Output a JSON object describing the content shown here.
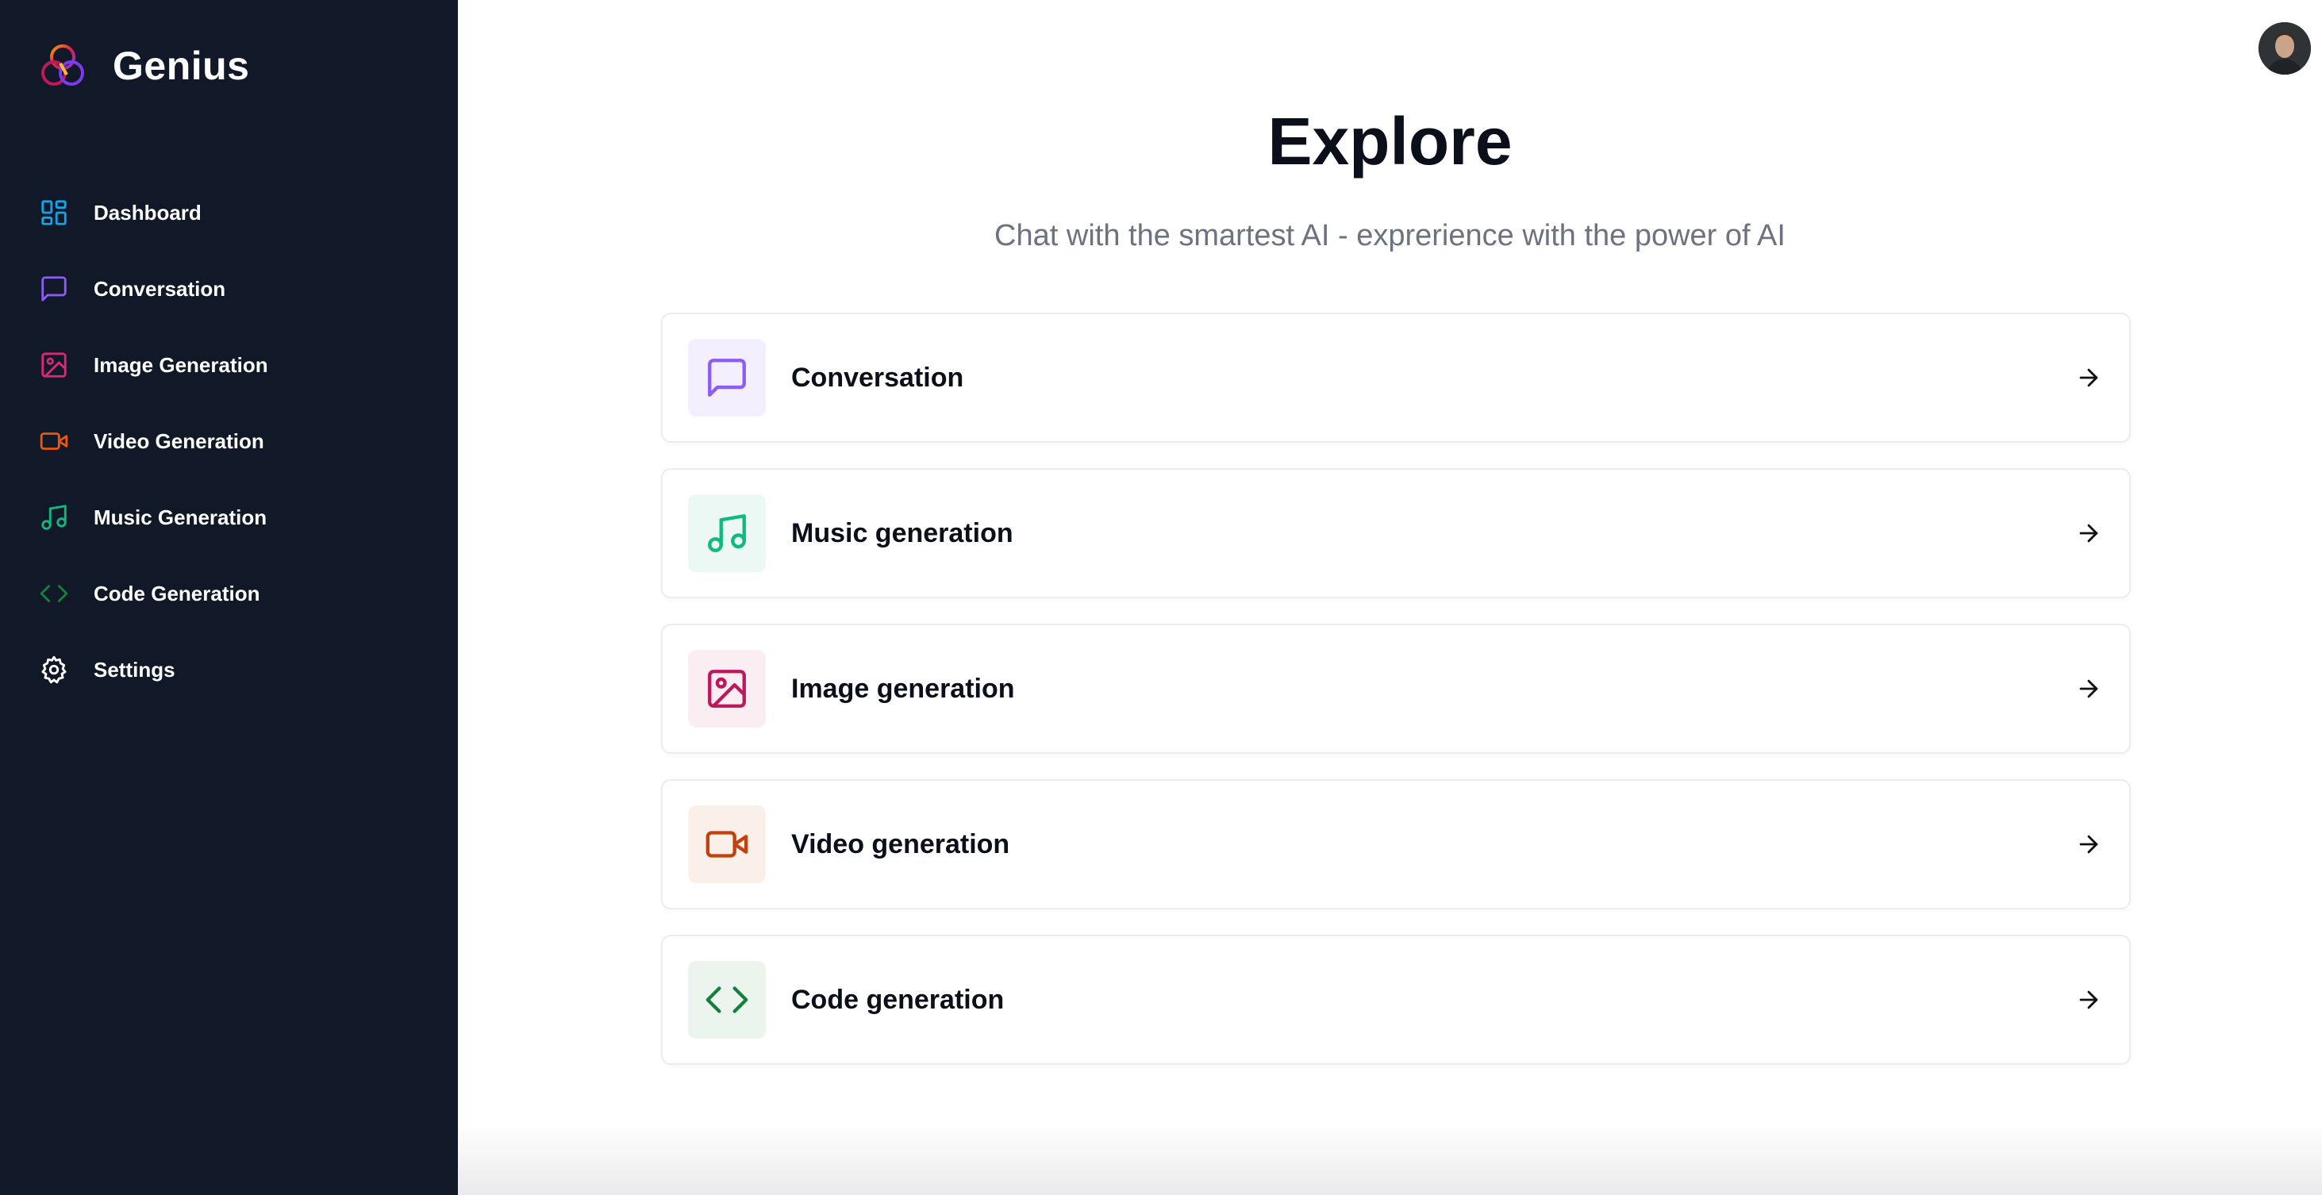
{
  "brand": {
    "name": "Genius",
    "icon": "genius-logo"
  },
  "sidebar": {
    "items": [
      {
        "label": "Dashboard",
        "icon": "dashboard-icon",
        "color": "#0ea5e9"
      },
      {
        "label": "Conversation",
        "icon": "message-square-icon",
        "color": "#8b5cf6"
      },
      {
        "label": "Image Generation",
        "icon": "image-icon",
        "color": "#db2777"
      },
      {
        "label": "Video Generation",
        "icon": "video-icon",
        "color": "#ea580c"
      },
      {
        "label": "Music Generation",
        "icon": "music-icon",
        "color": "#10b981"
      },
      {
        "label": "Code Generation",
        "icon": "code-icon",
        "color": "#15803d"
      },
      {
        "label": "Settings",
        "icon": "settings-icon",
        "color": "#ffffff"
      }
    ]
  },
  "header": {
    "avatar": "user-avatar"
  },
  "main": {
    "title": "Explore",
    "subtitle": "Chat with the smartest AI - exprerience with the power of AI",
    "tools": [
      {
        "label": "Conversation",
        "icon": "message-square-icon",
        "color": "#8b5cf6",
        "bg": "#f3efff"
      },
      {
        "label": "Music generation",
        "icon": "music-icon",
        "color": "#10b981",
        "bg": "#ecf8f3"
      },
      {
        "label": "Image generation",
        "icon": "image-icon",
        "color": "#be185d",
        "bg": "#fbeef3"
      },
      {
        "label": "Video generation",
        "icon": "video-icon",
        "color": "#c2410c",
        "bg": "#fbefe9"
      },
      {
        "label": "Code generation",
        "icon": "code-icon",
        "color": "#15803d",
        "bg": "#ebf5ee"
      }
    ]
  },
  "colors": {
    "sidebar_bg": "#111827",
    "text_primary": "#0b0f19",
    "text_muted": "#6b7280"
  }
}
